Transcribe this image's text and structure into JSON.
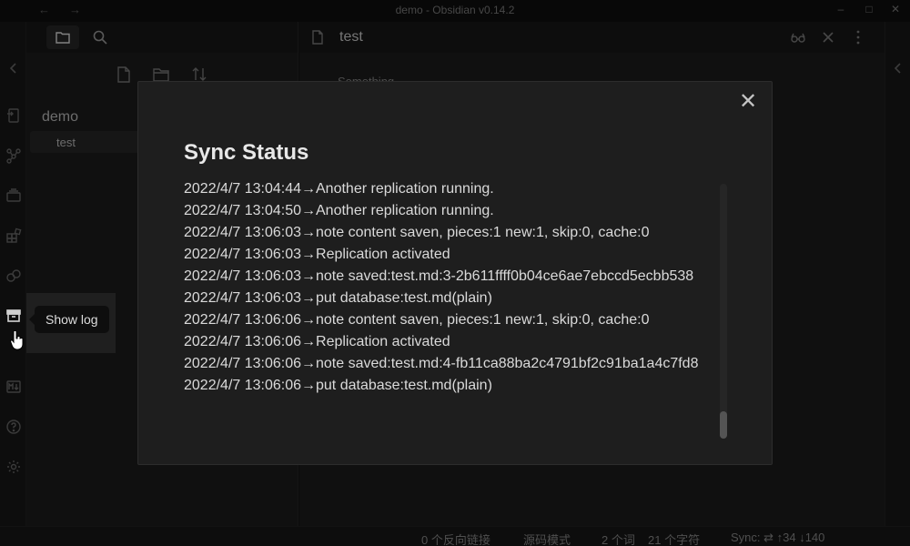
{
  "window": {
    "title": "demo - Obsidian v0.14.2",
    "back_glyph": "←",
    "forward_glyph": "→",
    "minimize_glyph": "–",
    "maximize_glyph": "□",
    "close_glyph": "✕"
  },
  "sidebar": {
    "vault_name": "demo",
    "files": [
      {
        "name": "test"
      }
    ]
  },
  "editor": {
    "tab_title": "test",
    "peek_text": "Something"
  },
  "tooltip": {
    "label": "Show log"
  },
  "modal": {
    "title": "Sync Status",
    "close_glyph": "✕",
    "log": [
      "2022/4/7 13:04:44→Another replication running.",
      "2022/4/7 13:04:50→Another replication running.",
      "2022/4/7 13:06:03→note content saven, pieces:1 new:1, skip:0, cache:0",
      "2022/4/7 13:06:03→Replication activated",
      "2022/4/7 13:06:03→note saved:test.md:3-2b611ffff0b04ce6ae7ebccd5ecbb538",
      "2022/4/7 13:06:03→put database:test.md(plain)",
      "2022/4/7 13:06:06→note content saven, pieces:1 new:1, skip:0, cache:0",
      "2022/4/7 13:06:06→Replication activated",
      "2022/4/7 13:06:06→note saved:test.md:4-fb11ca88ba2c4791bf2c91ba1a4c7fd8",
      "2022/4/7 13:06:06→put database:test.md(plain)"
    ]
  },
  "statusbar": {
    "backlinks": "0 个反向链接",
    "mode": "源码模式",
    "words": "2 个词",
    "chars": "21 个字符",
    "sync": "Sync: ⇄ ↑34 ↓140"
  },
  "colors": {
    "modal_bg": "#1e1e1e",
    "app_bg": "#111111",
    "text": "#dadada"
  },
  "icons": {
    "ribbon": [
      "collapse-left-icon",
      "switcher-icon",
      "graph-icon",
      "templates-icon",
      "community-plugins-icon",
      "sync-icon",
      "show-log-icon",
      "markdown-importer-icon",
      "help-icon",
      "settings-icon"
    ]
  }
}
